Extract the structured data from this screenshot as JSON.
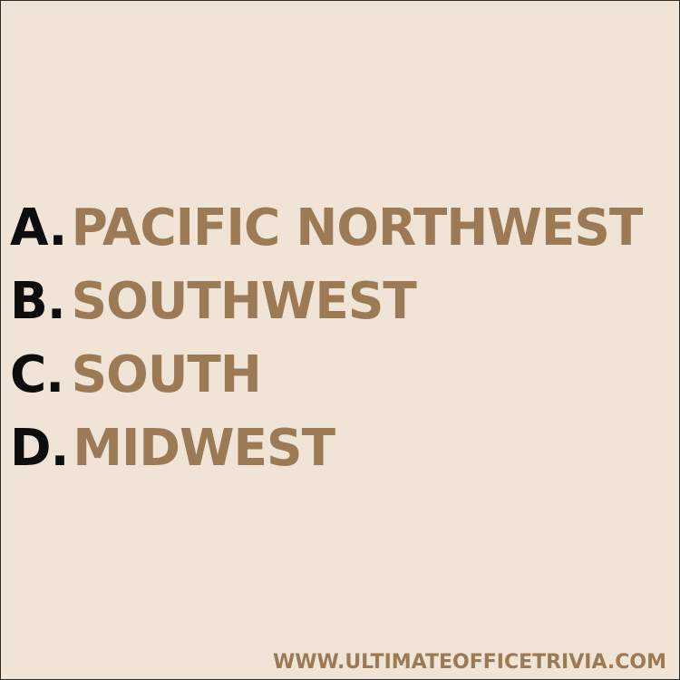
{
  "options": [
    {
      "letter": "A.",
      "text": "PACIFIC NORTHWEST"
    },
    {
      "letter": "B.",
      "text": "SOUTHWEST"
    },
    {
      "letter": "C.",
      "text": "SOUTH"
    },
    {
      "letter": "D.",
      "text": "MIDWEST"
    }
  ],
  "website": "WWW.ULTIMATEOFFICETRIVIA.COM",
  "colors": {
    "background": "#efe4d5",
    "letter": "#0d0d0d",
    "answer": "#9b7a55",
    "border": "#2b2b2b"
  }
}
